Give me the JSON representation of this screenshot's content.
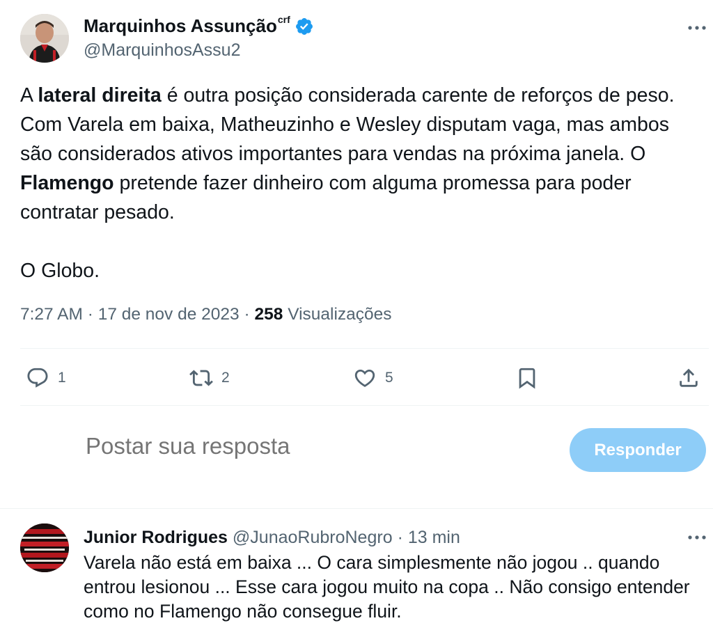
{
  "tweet": {
    "author_name": "Marquinhos Assunção",
    "author_name_suffix": "crf",
    "author_handle": "@MarquinhosAssu2",
    "text_parts": [
      {
        "text": "A ",
        "bold": false
      },
      {
        "text": "lateral direita",
        "bold": true
      },
      {
        "text": " é outra posição considerada carente de reforços de peso. Com Varela em baixa, Matheuzinho e Wesley disputam vaga, mas ambos são considerados ativos importantes para vendas na próxima janela. O ",
        "bold": false
      },
      {
        "text": "Flamengo",
        "bold": true
      },
      {
        "text": " pretende fazer dinheiro com alguma promessa para poder contratar pesado.",
        "bold": false
      }
    ],
    "source_line": "O Globo.",
    "time": "7:27 AM",
    "date": "17 de nov de 2023",
    "separator": "·",
    "views_count": "258",
    "views_label": "Visualizações",
    "more_icon": "more-horizontal-icon",
    "verified_icon": "verified-badge-icon"
  },
  "actions": {
    "reply": {
      "icon": "reply-bubble-icon",
      "count": "1"
    },
    "retweet": {
      "icon": "retweet-icon",
      "count": "2"
    },
    "like": {
      "icon": "heart-icon",
      "count": "5"
    },
    "bookmark": {
      "icon": "bookmark-icon"
    },
    "share": {
      "icon": "share-upload-icon"
    }
  },
  "composer": {
    "placeholder": "Postar sua resposta",
    "button_label": "Responder"
  },
  "reply": {
    "author_name": "Junior Rodrigues",
    "author_handle": "@JunaoRubroNegro",
    "separator": "·",
    "time": "13 min",
    "text": "Varela não está em baixa ... O cara simplesmente não jogou .. quando entrou lesionou ... Esse cara jogou muito na copa .. Não consigo entender como no Flamengo não consegue fluir."
  },
  "colors": {
    "text_primary": "#0f1419",
    "text_secondary": "#536471",
    "verified_blue": "#1d9bf0",
    "button_disabled_blue": "#8ecdf8",
    "divider": "#eff3f4"
  }
}
